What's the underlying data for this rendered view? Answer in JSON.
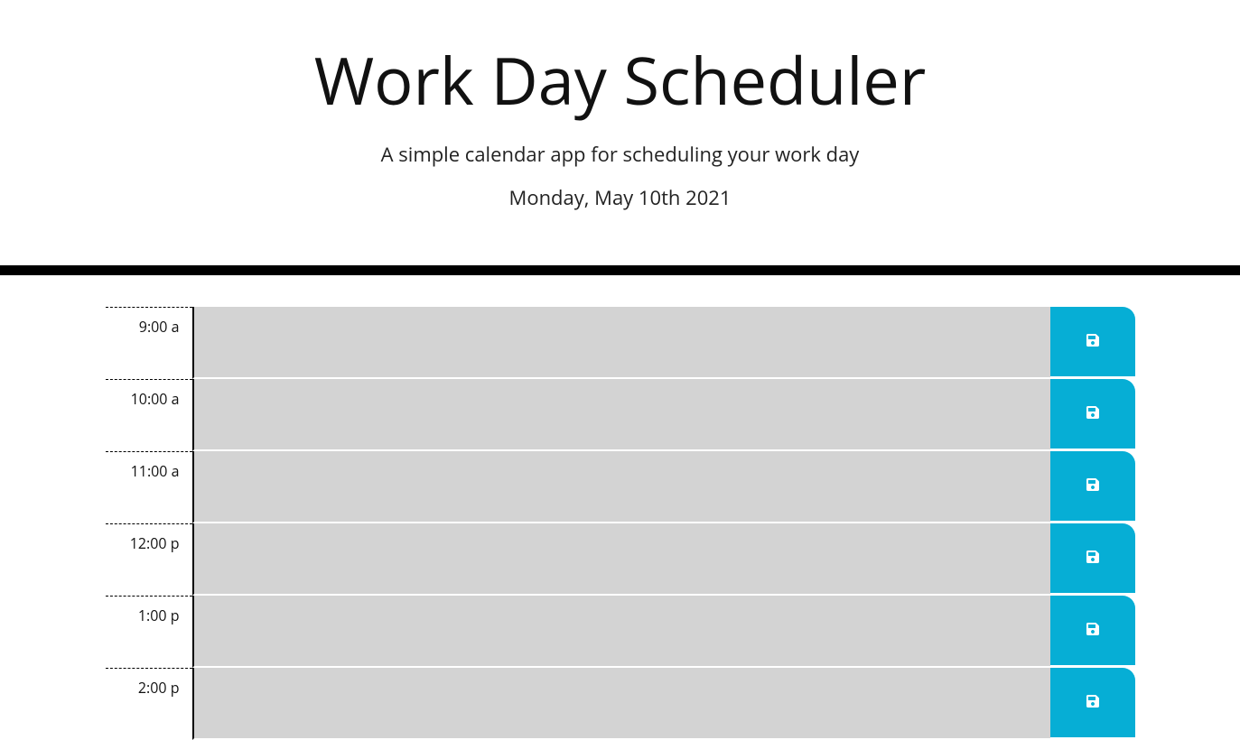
{
  "header": {
    "title": "Work Day Scheduler",
    "lead": "A simple calendar app for scheduling your work day",
    "currentDay": "Monday, May 10th 2021"
  },
  "timeBlocks": [
    {
      "hour": "9:00 a",
      "value": ""
    },
    {
      "hour": "10:00 a",
      "value": ""
    },
    {
      "hour": "11:00 a",
      "value": ""
    },
    {
      "hour": "12:00 p",
      "value": ""
    },
    {
      "hour": "1:00 p",
      "value": ""
    },
    {
      "hour": "2:00 p",
      "value": ""
    }
  ]
}
